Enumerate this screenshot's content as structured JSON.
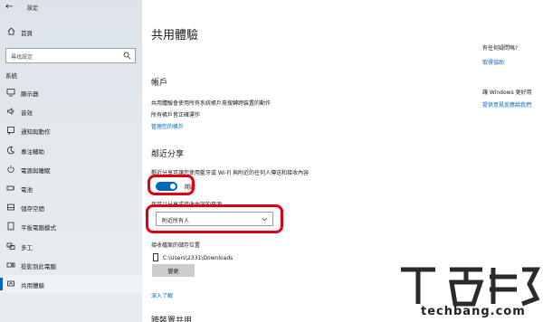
{
  "window": {
    "title": "設定"
  },
  "sidebar": {
    "home_label": "首頁",
    "search_placeholder": "尋找設定",
    "section_label": "系統",
    "items": [
      {
        "label": "顯示器",
        "icon": "monitor-icon"
      },
      {
        "label": "音效",
        "icon": "speaker-icon"
      },
      {
        "label": "通知與動作",
        "icon": "notification-icon"
      },
      {
        "label": "專注輔助",
        "icon": "moon-icon"
      },
      {
        "label": "電源與睡眠",
        "icon": "power-icon"
      },
      {
        "label": "電池",
        "icon": "battery-icon"
      },
      {
        "label": "儲存空間",
        "icon": "storage-icon"
      },
      {
        "label": "平板電腦模式",
        "icon": "tablet-icon"
      },
      {
        "label": "多工",
        "icon": "multitask-icon"
      },
      {
        "label": "投影到此電腦",
        "icon": "projector-icon"
      },
      {
        "label": "共用體驗",
        "icon": "shared-icon"
      }
    ],
    "active_index": 10
  },
  "main": {
    "title": "共用體驗",
    "accounts": {
      "heading": "帳戶",
      "line1": "共用體驗會使用所有系統帳戶來搜轉跨裝置的動作",
      "line2": "所有帳戶皆正確運作",
      "link": "管理您的帳戶"
    },
    "nearby": {
      "heading": "鄰近分享",
      "description": "鄰近分享可讓您使用藍牙或 Wi-Fi 與附近的任何人傳送和接收內容",
      "toggle_label": "開啟",
      "toggle_on": true,
      "share_label": "我可以分享或接收內容的來源",
      "dropdown_value": "附近所有人",
      "save_location_label": "接收檔案的儲存位置",
      "save_path": "C:\\Users\\2331\\Downloads",
      "change_button": "變更",
      "learn_more": "深入了解",
      "next_heading": "跨裝置共用"
    },
    "right": {
      "q1": "有任何疑問嗎?",
      "q1_link": "取得協助",
      "q2": "讓 Windows 更好用",
      "q2_link": "提供意見反應給我們"
    }
  },
  "watermark": {
    "text": "techbang.com"
  },
  "colors": {
    "accent": "#0067c0",
    "highlight": "#e10012"
  }
}
